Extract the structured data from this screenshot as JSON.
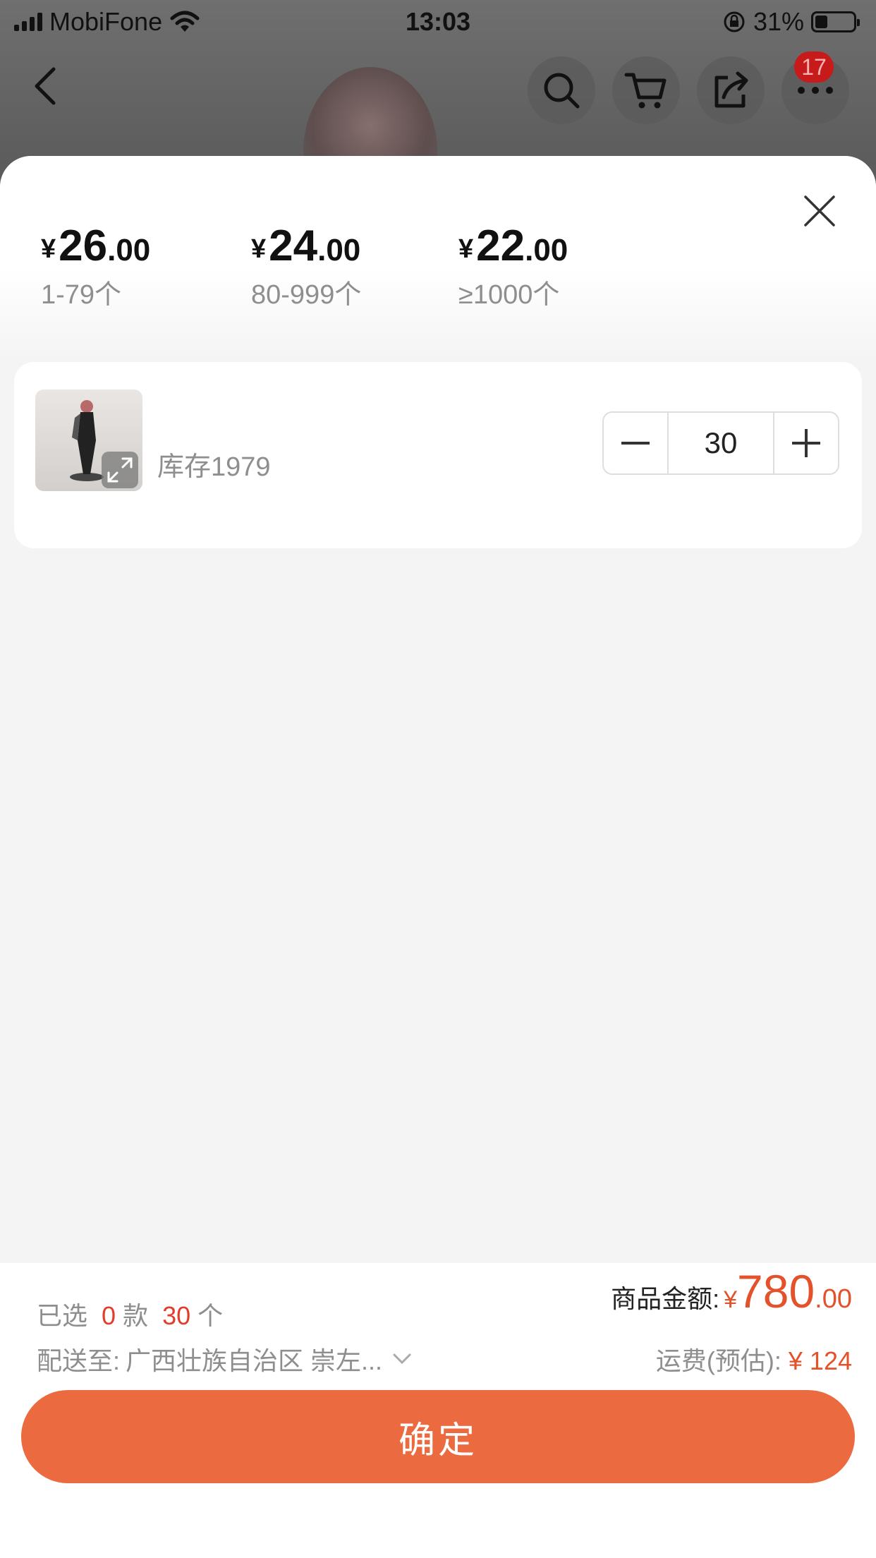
{
  "status_bar": {
    "carrier": "MobiFone",
    "time": "13:03",
    "battery_pct": "31%"
  },
  "nav": {
    "badge_count": "17"
  },
  "price_tiers": [
    {
      "currency": "¥",
      "int": "26",
      "dec": ".00",
      "range": "1-79个"
    },
    {
      "currency": "¥",
      "int": "24",
      "dec": ".00",
      "range": "80-999个"
    },
    {
      "currency": "¥",
      "int": "22",
      "dec": ".00",
      "range": "≥1000个"
    }
  ],
  "sku": {
    "stock": "库存1979",
    "quantity": "30"
  },
  "summary": {
    "selected_prefix": "已选",
    "styles_count": "0",
    "styles_unit": "款",
    "items_count": "30",
    "items_unit": "个",
    "ship_label": "配送至:",
    "ship_address": "广西壮族自治区 崇左...",
    "amount_label": "商品金额:",
    "amount_currency": "¥",
    "amount_int": "780",
    "amount_dec": ".00",
    "freight_label": "运费(预估):",
    "freight_value": "¥ 124"
  },
  "confirm_label": "确定"
}
